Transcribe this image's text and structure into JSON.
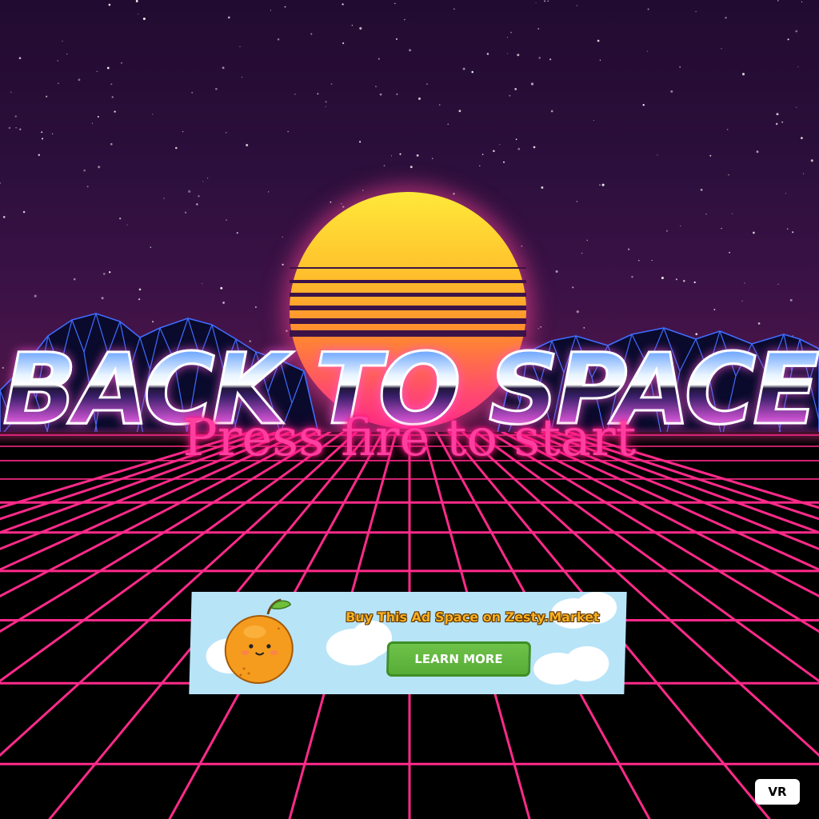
{
  "game": {
    "title": "BACK TO SPACE",
    "prompt": "Press fire to start"
  },
  "ad": {
    "headline": "Buy This Ad Space on Zesty.Market",
    "button_label": "LEARN MORE"
  },
  "vr_button_label": "VR",
  "colors": {
    "sky_top": "#220b30",
    "sun_top": "#ffe83a",
    "sun_bottom": "#ff2f86",
    "grid_line": "#ff2a8a",
    "mountain_line": "#3f6cff",
    "prompt_text": "#ff3fa0",
    "ad_background": "#b8e4f8",
    "ad_button": "#56ad36"
  }
}
